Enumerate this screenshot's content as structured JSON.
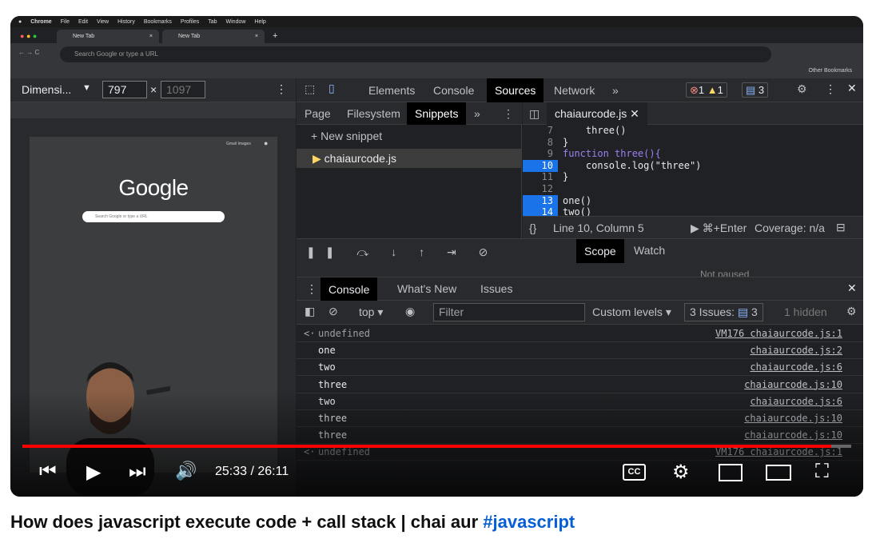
{
  "mac_menu": [
    "Chrome",
    "File",
    "Edit",
    "View",
    "History",
    "Bookmarks",
    "Profiles",
    "Tab",
    "Window",
    "Help"
  ],
  "browser": {
    "tabs": [
      "New Tab",
      "New Tab"
    ],
    "omnibox_placeholder": "Search Google or type a URL",
    "other_bookmarks": "Other Bookmarks"
  },
  "device_toolbar": {
    "dimensions": "Dimensi...",
    "width": "797",
    "height": "1097"
  },
  "phone_preview": {
    "logo": "Google",
    "search_placeholder": "Search Google or type a URL",
    "links": "Gmail   Images"
  },
  "devtools": {
    "tabs": [
      "Elements",
      "Console",
      "Sources",
      "Network"
    ],
    "active_tab": "Sources",
    "error_count": "1",
    "warning_count": "1",
    "issue_count": "3",
    "navigator_tabs": [
      "Page",
      "Filesystem",
      "Snippets"
    ],
    "new_snippet": "New snippet",
    "snippet_file": "chaiaurcode.js",
    "open_file": "chaiaurcode.js",
    "code_lines": [
      {
        "n": "7",
        "text": "    three()"
      },
      {
        "n": "8",
        "text": "}"
      },
      {
        "n": "9",
        "text": "function three(){"
      },
      {
        "n": "10",
        "text": "    console.log(\"three\")"
      },
      {
        "n": "11",
        "text": "}"
      },
      {
        "n": "12",
        "text": ""
      },
      {
        "n": "13",
        "text": "one()"
      },
      {
        "n": "14",
        "text": "two()"
      }
    ],
    "status_position": "Line 10, Column 5",
    "run_hint": "▶ ⌘+Enter",
    "coverage": "Coverage: n/a",
    "debug_tabs": [
      "Scope",
      "Watch"
    ],
    "not_paused": "Not paused",
    "console_tabs": [
      "Console",
      "What's New",
      "Issues"
    ],
    "context": "top",
    "filter_placeholder": "Filter",
    "levels": "Custom levels",
    "issues_label": "3 Issues:",
    "hidden": "1 hidden",
    "messages": [
      {
        "arrow": "<·",
        "text": "undefined",
        "src": "VM176 chaiaurcode.js:1"
      },
      {
        "arrow": "",
        "text": "one",
        "src": "chaiaurcode.js:2"
      },
      {
        "arrow": "",
        "text": "two",
        "src": "chaiaurcode.js:6"
      },
      {
        "arrow": "",
        "text": "three",
        "src": "chaiaurcode.js:10"
      },
      {
        "arrow": "",
        "text": "two",
        "src": "chaiaurcode.js:6"
      },
      {
        "arrow": "",
        "text": "three",
        "src": "chaiaurcode.js:10"
      },
      {
        "arrow": "",
        "text": "three",
        "src": "chaiaurcode.js:10"
      },
      {
        "arrow": "<·",
        "text": "undefined",
        "src": "VM176 chaiaurcode.js:1"
      }
    ]
  },
  "player": {
    "time": "25:33 / 26:11",
    "progress_fraction": 0.976
  },
  "video_title": "How does javascript execute code + call stack | chai aur ",
  "video_hashtag": "#javascript"
}
